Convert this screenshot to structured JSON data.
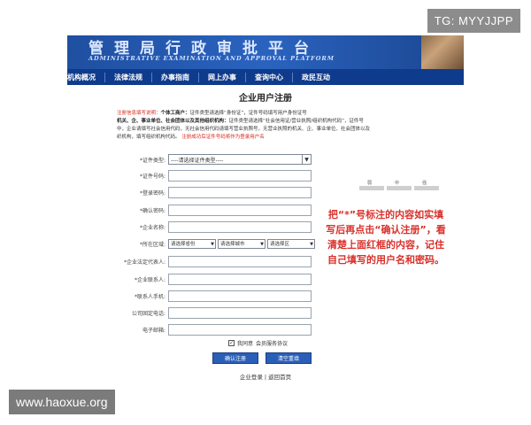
{
  "watermarks": {
    "top_right": "TG: MYYJJPP",
    "bottom_left": "www.haoxue.org"
  },
  "banner": {
    "title": "管理局行政审批平台",
    "subtitle": "ADMINISTRATIVE EXAMINATION AND APPROVAL PLATFORM"
  },
  "nav": {
    "items": [
      "机构概况",
      "法律法规",
      "办事指南",
      "网上办事",
      "查询中心",
      "政民互动"
    ]
  },
  "form": {
    "title": "企业用户注册",
    "notes": {
      "label": "注册信息填写说明：",
      "line1_bold": "个体工商户：",
      "line1_text": "证件类型请选择“身份证”，证件号码填写用户身份证号",
      "line2_bold": "机关、企、事业单位、社会团体以及其他组织机构：",
      "line2_text": "证件类型请选择“社会信用证/营业执照/组织机构代码”，证件号",
      "line3_text": "中，企业请填写社会信用代码，无社会信用代码请填写营业执照号，无营业执照的机关、企、事业单位、社会团体以及",
      "line4_text": "织机构，填写组织机构代码。",
      "line4_red": "注册成功后证件号码将作为登录用户名"
    },
    "fields": [
      {
        "label": "*证件类型:",
        "type": "select",
        "value": "----请选择证件类型----"
      },
      {
        "label": "*证件号码:",
        "type": "input"
      },
      {
        "label": "*登录密码:",
        "type": "input"
      },
      {
        "label": "*确认密码:",
        "type": "input"
      },
      {
        "label": "*企业名称:",
        "type": "input"
      },
      {
        "label": "*所在区域:",
        "type": "region"
      },
      {
        "label": "*企业法定代表人:",
        "type": "input"
      },
      {
        "label": "*企业联系人:",
        "type": "input"
      },
      {
        "label": "*联系人手机:",
        "type": "input"
      },
      {
        "label": "公司固定电话:",
        "type": "input"
      },
      {
        "label": "电子邮箱:",
        "type": "input"
      }
    ],
    "region": {
      "province": "请选择省份",
      "city": "请选择城市",
      "district": "请选择区"
    },
    "strength": {
      "weak": "弱",
      "medium": "中",
      "strong": "强"
    },
    "agree_text": "我同意",
    "agree_link": "会员服务协议",
    "agree_check": "✓",
    "confirm_button": "确认注册",
    "clear_button": "清空重填",
    "footer_login": "企业登录",
    "footer_sep": "|",
    "footer_home": "返回首页"
  },
  "annotation": {
    "text": "把“*”号标注的内容如实填写后再点击“确认注册”，看清楚上面红框的内容，记住自己填写的用户名和密码。"
  },
  "colors": {
    "banner": "#2a63bf",
    "nav": "#0f3b8c",
    "button": "#2a5fb8",
    "annotation": "#d9302b"
  }
}
